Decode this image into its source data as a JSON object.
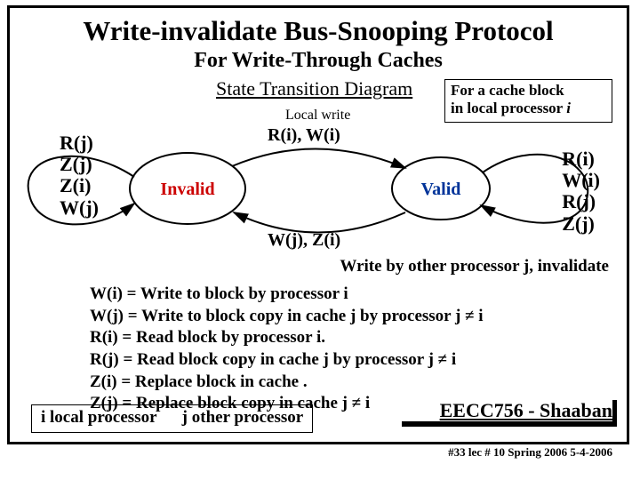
{
  "header": {
    "title": "Write-invalidate Bus-Snooping Protocol",
    "subtitle": "For Write-Through Caches",
    "subsub": "State Transition Diagram"
  },
  "note": {
    "line1": "For a cache block",
    "line2_pre": "in local processor ",
    "line2_i": "i"
  },
  "labels": {
    "local_write": "Local write",
    "top_arrow": "R(i), W(i)",
    "bottom_arrow": "W(j), Z(i)"
  },
  "states": {
    "invalid": "Invalid",
    "invalid_color": "#cc0000",
    "valid": "Valid",
    "valid_color": "#003399"
  },
  "left_self": [
    "R(j)",
    "Z(j)",
    "Z(i)",
    "W(j)"
  ],
  "right_self": [
    "R(i)",
    "W(i)",
    "R(j)",
    "Z(j)"
  ],
  "invalidate_note": "Write by other processor j, invalidate",
  "legend": [
    "W(i) =  Write to block by processor i",
    "W(j) = Write to block copy in cache j by processor j  ≠  i",
    "R(i) = Read block by processor i.",
    "R(j) = Read block copy in cache j by processor j  ≠ i",
    "Z(i) = Replace block in cache .",
    "Z(j) = Replace block copy in cache j ≠ i"
  ],
  "footer": {
    "i": "i  local processor",
    "j": "j   other processor"
  },
  "course": "EECC756 - Shaaban",
  "lec": "#33  lec # 10   Spring 2006   5-4-2006",
  "chart_data": {
    "type": "state-diagram",
    "title": "Write-invalidate Bus-Snooping Protocol state transitions for write-through caches",
    "states": [
      "Invalid",
      "Valid"
    ],
    "transitions": [
      {
        "from": "Invalid",
        "to": "Invalid",
        "on": [
          "R(j)",
          "Z(j)",
          "Z(i)",
          "W(j)"
        ]
      },
      {
        "from": "Invalid",
        "to": "Valid",
        "on": [
          "R(i)",
          "W(i)"
        ],
        "note": "Local write"
      },
      {
        "from": "Valid",
        "to": "Valid",
        "on": [
          "R(i)",
          "W(i)",
          "R(j)",
          "Z(j)"
        ]
      },
      {
        "from": "Valid",
        "to": "Invalid",
        "on": [
          "W(j)",
          "Z(i)"
        ],
        "note": "Write by other processor j, invalidate"
      }
    ],
    "symbol_legend": {
      "W(i)": "Write to block by processor i",
      "W(j)": "Write to block copy in cache j by processor j ≠ i",
      "R(i)": "Read block by processor i",
      "R(j)": "Read block copy in cache j by processor j ≠ i",
      "Z(i)": "Replace block in cache",
      "Z(j)": "Replace block copy in cache j ≠ i"
    }
  }
}
